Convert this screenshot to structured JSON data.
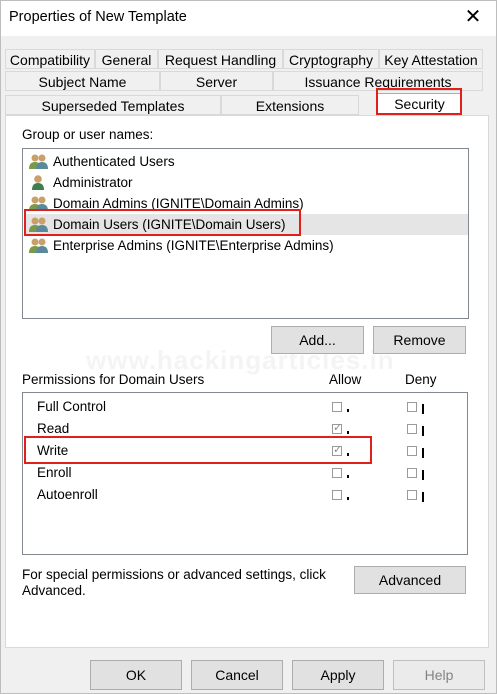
{
  "window": {
    "title": "Properties of New Template",
    "close_glyph": "✕"
  },
  "tabs": {
    "row1": [
      "Compatibility",
      "General",
      "Request Handling",
      "Cryptography",
      "Key Attestation"
    ],
    "row2": [
      "Subject Name",
      "Server",
      "Issuance Requirements"
    ],
    "row3": [
      "Superseded Templates",
      "Extensions",
      "Security"
    ],
    "selected": "Security"
  },
  "security": {
    "group_label": "Group or user names:",
    "users": [
      "Authenticated Users",
      "Administrator",
      "Domain Admins (IGNITE\\Domain Admins)",
      "Domain Users (IGNITE\\Domain Users)",
      "Enterprise Admins (IGNITE\\Enterprise Admins)"
    ],
    "selected_user": "Domain Users (IGNITE\\Domain Users)",
    "add_label": "Add...",
    "remove_label": "Remove",
    "permissions_label": "Permissions for Domain Users",
    "allow_label": "Allow",
    "deny_label": "Deny",
    "permissions": [
      {
        "name": "Full Control",
        "allow": false,
        "deny": false
      },
      {
        "name": "Read",
        "allow": true,
        "deny": false
      },
      {
        "name": "Write",
        "allow": true,
        "deny": false
      },
      {
        "name": "Enroll",
        "allow": false,
        "deny": false
      },
      {
        "name": "Autoenroll",
        "allow": false,
        "deny": false
      }
    ],
    "special_text_line1": "For special permissions or advanced settings, click",
    "special_text_line2": "Advanced.",
    "advanced_label": "Advanced",
    "watermark": "www.hackingarticles.in"
  },
  "footer": {
    "ok": "OK",
    "cancel": "Cancel",
    "apply": "Apply",
    "help": "Help"
  },
  "colors": {
    "highlight": "#e0201b",
    "window_bg": "#f0f0f0",
    "selected_row": "#e5e5e5"
  }
}
